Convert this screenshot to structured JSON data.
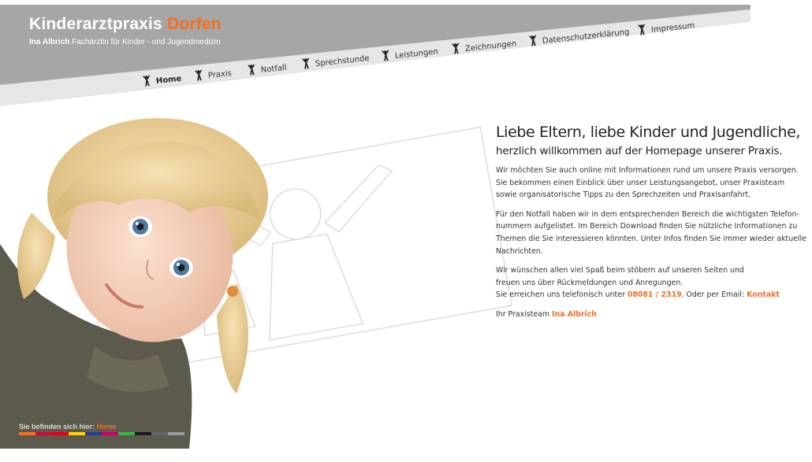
{
  "header": {
    "title_main": "Kinderarztpraxis ",
    "title_accent": "Dorfen",
    "subtitle_name": "Ina Albrich",
    "subtitle_rest": " Fachärztin für Kinder - und Jugendmedizin"
  },
  "nav": [
    {
      "label": "Home",
      "icon": "person-figure-icon",
      "active": true
    },
    {
      "label": "Praxis",
      "icon": "person-figure-icon"
    },
    {
      "label": "Notfall",
      "icon": "person-figure-icon"
    },
    {
      "label": "Sprechstunde",
      "icon": "person-figure-icon"
    },
    {
      "label": "Leistungen",
      "icon": "person-figure-icon"
    },
    {
      "label": "Zeichnungen",
      "icon": "person-figure-icon"
    },
    {
      "label": "Datenschutzerklärung",
      "icon": "person-figure-icon"
    },
    {
      "label": "Impressum",
      "icon": "person-figure-icon"
    }
  ],
  "content": {
    "heading": "Liebe Eltern, liebe Kinder und Jugendliche,",
    "subheading": "herzlich willkommen auf der Homepage unserer Praxis.",
    "para1": "Wir möchten Sie auch online mit Informationen rund um unsere Praxis versorgen. Sie bekommen einen Einblick über unser Leistungsangebot, unser Praxisteam sowie organisatorische Tipps zu den Sprechzeiten und Praxisanfahrt.",
    "para2": "Für den Notfall haben wir in dem entsprechenden Bereich die wichtigsten Telefon-nummern aufgelistet. Im Bereich Download finden Sie nützliche Informationen zu Themen die Sie interessieren könnten. Unter Infos finden Sie immer wieder aktuelle Nachrichten.",
    "para3_line1": "Wir wünschen allen viel Spaß beim stöbern auf unseren Seiten und",
    "para3_line2": "freuen uns über Rückmeldungen und Anregungen.",
    "para3_line3_pre": "Sie erreichen uns telefonisch unter ",
    "phone": "08081 / 2319",
    "para3_line3_mid": ". Oder per Email: ",
    "email_link": "Kontakt",
    "sign_pre": "Ihr Praxisteam ",
    "sign_name": "Ina Albrich"
  },
  "breadcrumb": {
    "prefix": "Sie befinden sich hier: ",
    "current": "Home"
  },
  "colors": {
    "accent": "#f36f21",
    "header_gray": "#a6a6a6",
    "nav_band": "#e6e6e6",
    "stripes": [
      "#f36f21",
      "#c8102e",
      "#e2001a",
      "#ffd400",
      "#2a3d8f",
      "#c8006e",
      "#39b54a",
      "#1a1a1a",
      "#666666",
      "#999999"
    ]
  }
}
